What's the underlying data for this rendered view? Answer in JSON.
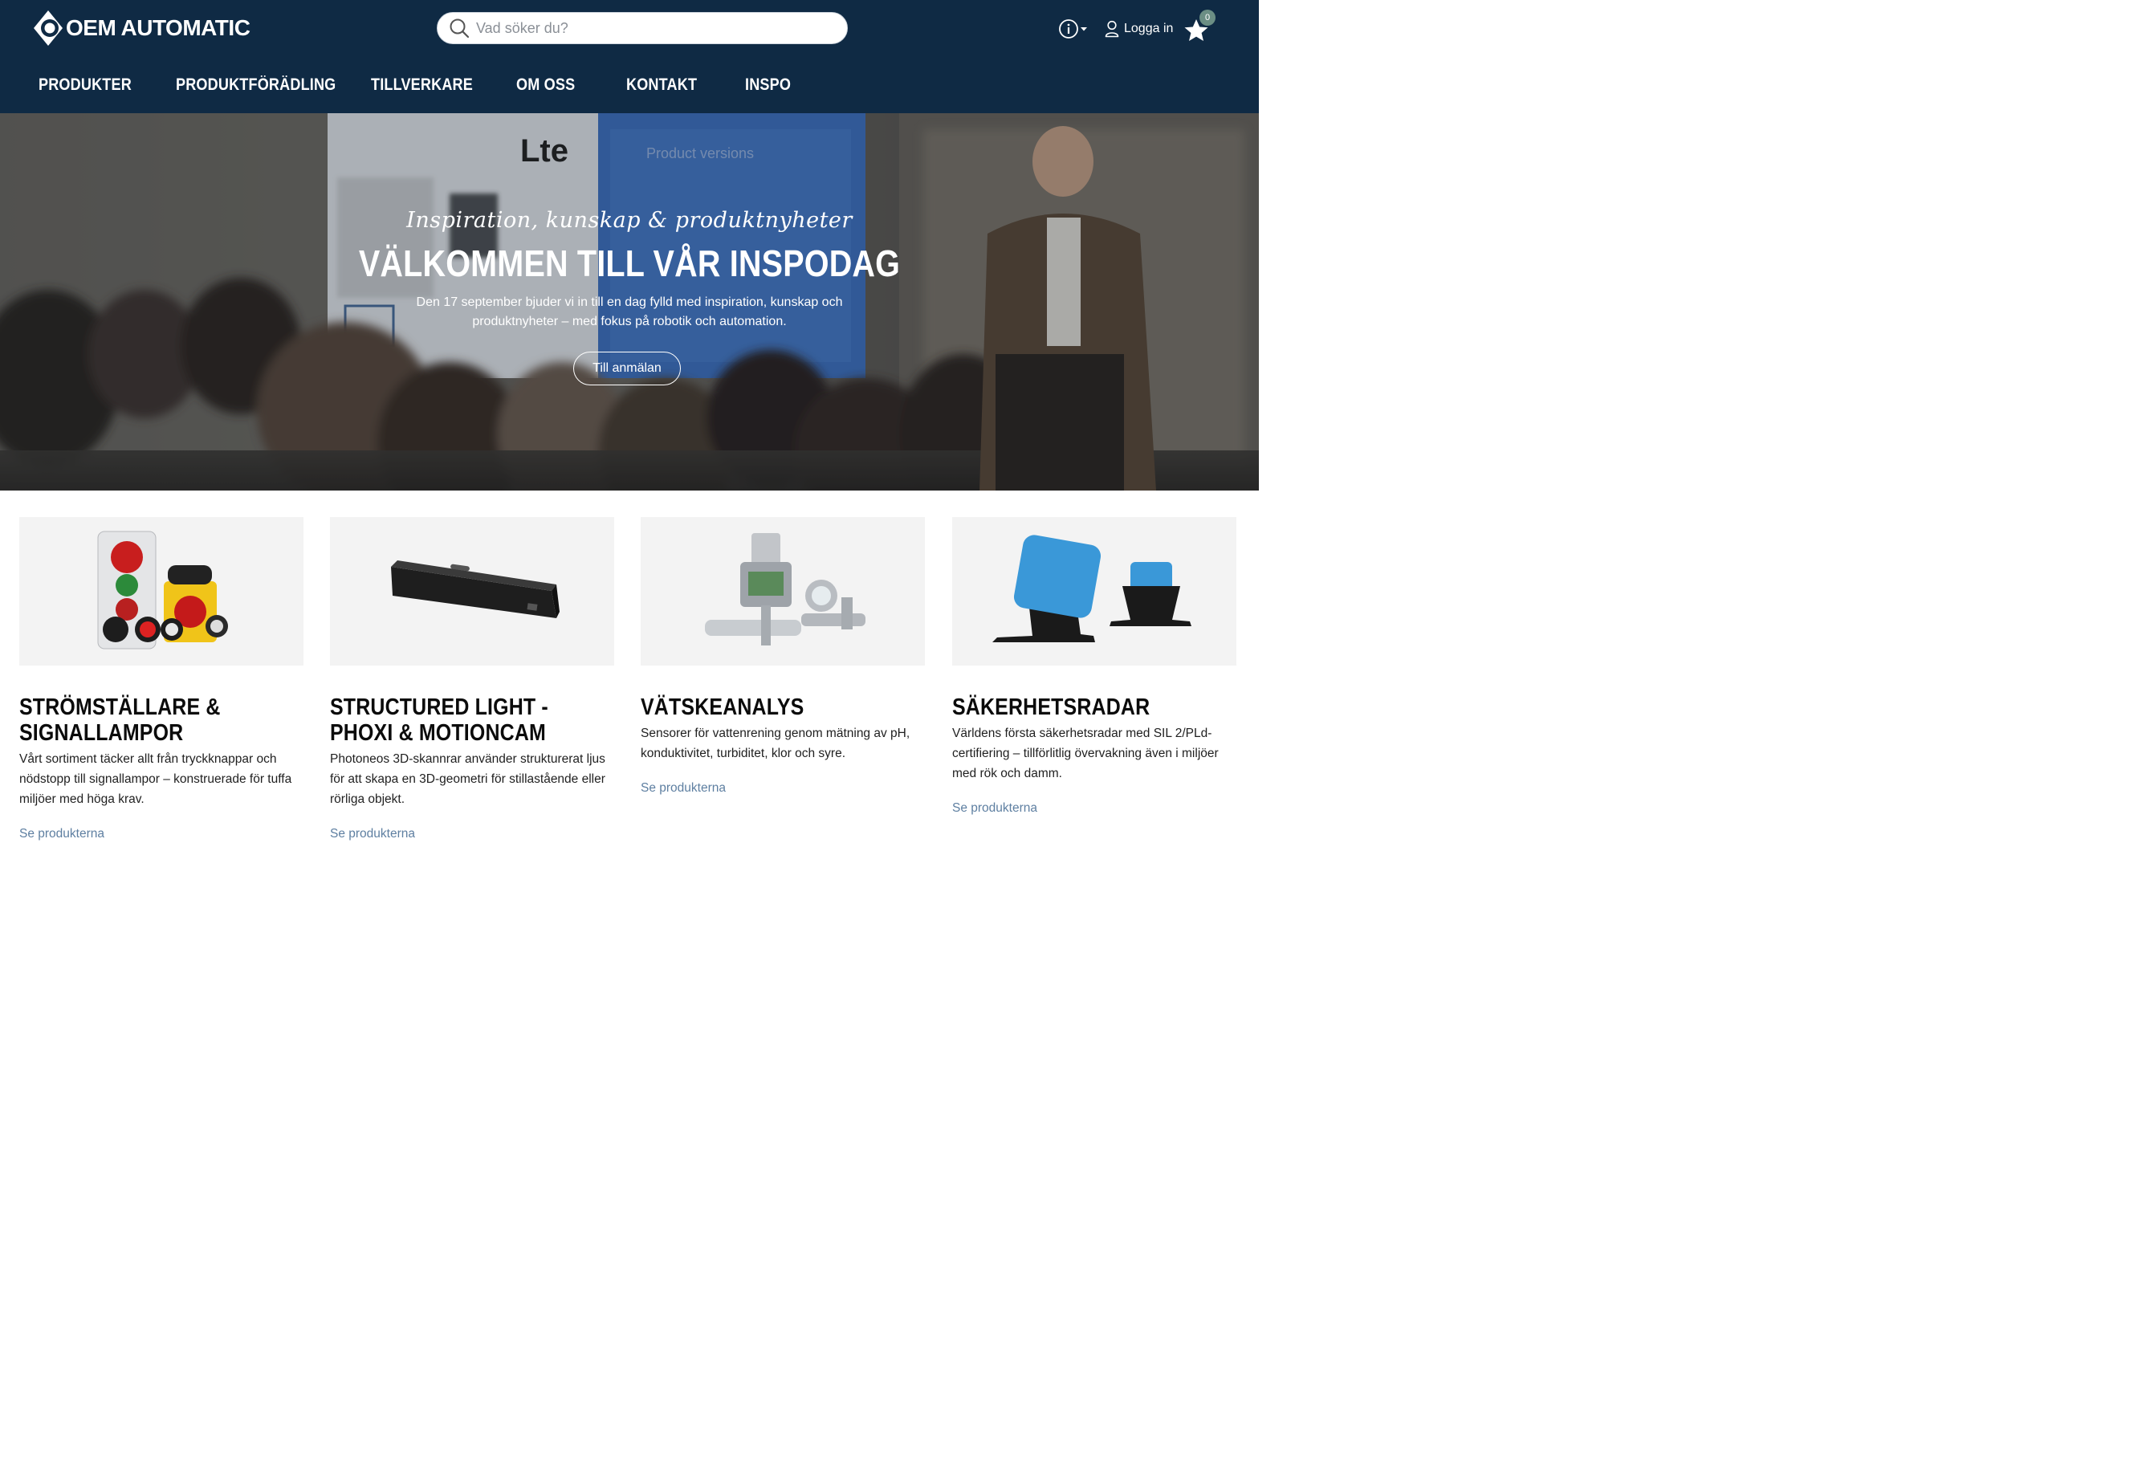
{
  "header": {
    "logo_text": "OEM AUTOMATIC",
    "search_placeholder": "Vad söker du?",
    "login_label": "Logga in",
    "favorites_count": "0",
    "colors": {
      "header_bg": "#0f2a44",
      "badge": "#6b8e84"
    }
  },
  "nav": {
    "items": [
      {
        "label": "PRODUKTER"
      },
      {
        "label": "PRODUKTFÖRÄDLING"
      },
      {
        "label": "TILLVERKARE"
      },
      {
        "label": "OM OSS"
      },
      {
        "label": "KONTAKT"
      },
      {
        "label": "INSPO"
      }
    ]
  },
  "hero": {
    "script": "Inspiration, kunskap & produktnyheter",
    "title": "VÄLKOMMEN TILL VÅR INSPODAG",
    "text": "Den 17 september bjuder vi in till en dag fylld med inspiration, kunskap och produktnyheter – med fokus på robotik och automation.",
    "button": "Till anmälan"
  },
  "cards": [
    {
      "title": "STRÖMSTÄLLARE & SIGNALLAMPOR",
      "text": "Vårt sortiment täcker allt från tryckknappar och nödstopp till signallampor – konstruerade för tuffa miljöer med höga krav.",
      "link": "Se produkterna"
    },
    {
      "title": "STRUCTURED LIGHT - PHOXI & MOTIONCAM",
      "text": "Photoneos 3D-skannrar använder strukturerat ljus för att skapa en 3D-geometri för stillastående eller rörliga objekt.",
      "link": "Se produkterna"
    },
    {
      "title": "VÄTSKEANALYS",
      "text": "Sensorer för vattenrening genom mätning av pH, konduktivitet, turbiditet, klor och syre.",
      "link": "Se produkterna"
    },
    {
      "title": "SÄKERHETSRADAR",
      "text": "Världens första säkerhetsradar med SIL 2/PLd-certifiering – tillförlitlig övervakning även i miljöer med rök och damm.",
      "link": "Se produkterna"
    }
  ]
}
